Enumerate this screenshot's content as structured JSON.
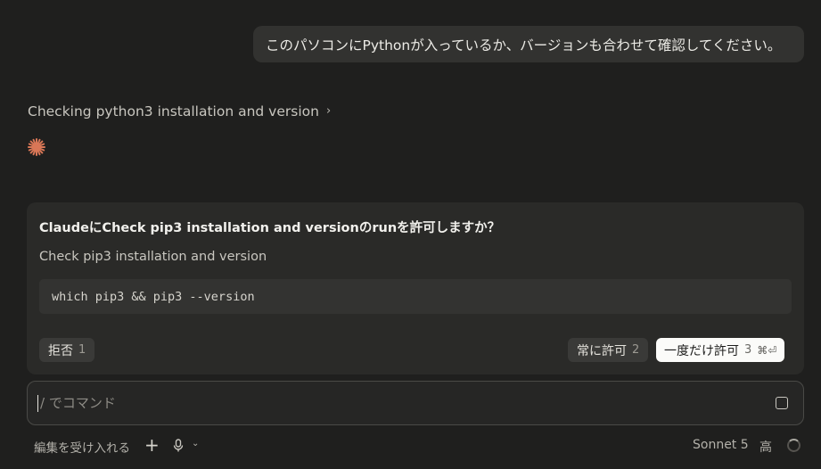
{
  "user_message": "このパソコンにPythonが入っているか、バージョンも合わせて確認してください。",
  "status": {
    "text": "Checking python3 installation and version",
    "icon": "chevron-right-icon"
  },
  "spinner_icon": "sparkle-icon",
  "accent_color": "#d97757",
  "permission": {
    "title": "ClaudeにCheck pip3 installation and versionのrunを許可しますか？",
    "description": "Check pip3 installation and version",
    "command": "which pip3 && pip3 --version",
    "deny": {
      "label": "拒否",
      "key": "1"
    },
    "always_allow": {
      "label": "常に許可",
      "key": "2"
    },
    "allow_once": {
      "label": "一度だけ許可",
      "key": "3",
      "shortcut": "⌘⏎"
    }
  },
  "input": {
    "placeholder": "/ でコマンド",
    "value": ""
  },
  "footer": {
    "accept_edits": "編集を受け入れる",
    "add_icon": "plus-icon",
    "mic_icon": "microphone-icon",
    "model": "Sonnet 5",
    "effort": "高"
  }
}
